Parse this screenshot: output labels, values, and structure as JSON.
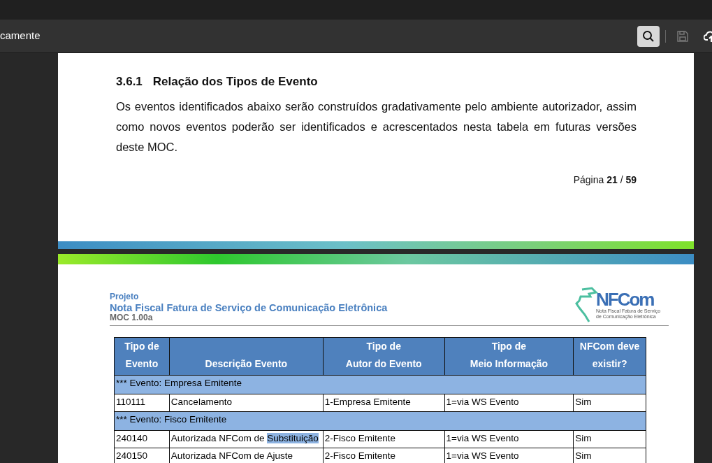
{
  "toolbar": {
    "title": "camente",
    "buttons": [
      {
        "kind": "search",
        "selected": true,
        "disabled": false
      },
      {
        "kind": "save",
        "selected": false,
        "disabled": true
      },
      {
        "kind": "upload",
        "selected": false,
        "disabled": false
      }
    ]
  },
  "page_top": {
    "section_number": "3.6.1",
    "section_title": "Relação dos Tipos de Evento",
    "paragraph": "Os eventos identificados abaixo serão construídos gradativamente pelo ambiente autorizador, assim como novos eventos poderão ser identificados e acrescentados nesta tabela em futuras versões deste MOC.",
    "page_label": "Página **21** / **59**"
  },
  "page_bottom": {
    "project_label": "Projeto",
    "project_name": "Nota Fiscal Fatura de Serviço de Comunicação Eletrônica",
    "version": "MOC 1.00a",
    "logo_text": "NFCom",
    "logo_caption": "Nota Fiscal Fatura de Serviço de Comunicação Eletrônica",
    "table": {
      "columns": [
        [
          "Tipo de",
          "Evento"
        ],
        [
          "Descrição Evento"
        ],
        [
          "Tipo de",
          "Autor do Evento"
        ],
        [
          "Tipo de",
          "Meio Informação"
        ],
        [
          "NFCom deve",
          "existir?"
        ]
      ],
      "rows": [
        {
          "kind": "group",
          "text": "*** Evento: Empresa Emitente"
        },
        {
          "kind": "data",
          "cells": [
            [
              {
                "text": "110111",
                "selected": false
              }
            ],
            [
              {
                "text": "Cancelamento",
                "selected": false
              }
            ],
            [
              {
                "text": "1-Empresa Emitente",
                "selected": false
              }
            ],
            [
              {
                "text": "1=via WS Evento",
                "selected": false
              }
            ],
            [
              {
                "text": "Sim",
                "selected": false
              }
            ]
          ]
        },
        {
          "kind": "group",
          "text": "*** Evento: Fisco Emitente"
        },
        {
          "kind": "data",
          "cells": [
            [
              {
                "text": "240140",
                "selected": false
              }
            ],
            [
              {
                "text": "Autorizada NFCom de ",
                "selected": false
              },
              {
                "text": "Substituição",
                "selected": true
              }
            ],
            [
              {
                "text": "2-Fisco Emitente",
                "selected": false
              }
            ],
            [
              {
                "text": "1=via WS Evento",
                "selected": false
              }
            ],
            [
              {
                "text": "Sim",
                "selected": false
              }
            ]
          ]
        },
        {
          "kind": "data",
          "cells": [
            [
              {
                "text": "240150",
                "selected": false
              }
            ],
            [
              {
                "text": "Autorizada NFCom de Ajuste",
                "selected": false
              }
            ],
            [
              {
                "text": "2-Fisco Emitente",
                "selected": false
              }
            ],
            [
              {
                "text": "1=via WS Evento",
                "selected": false
              }
            ],
            [
              {
                "text": "Sim",
                "selected": false
              }
            ]
          ]
        }
      ]
    }
  }
}
